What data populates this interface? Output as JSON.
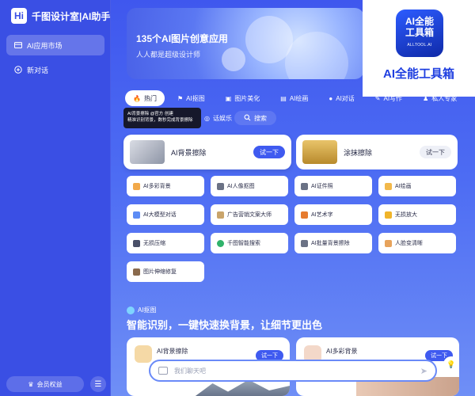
{
  "sidebar": {
    "logo_mark": "Hi",
    "logo_text": "千图设计室|AI助手",
    "items": [
      {
        "label": "AI应用市场",
        "icon": "app-store-icon"
      },
      {
        "label": "新对话",
        "icon": "plus-circle-icon"
      }
    ],
    "member_label": "会员权益",
    "menu_icon": "menu-icon"
  },
  "banner": {
    "title": "135个AI图片创意应用",
    "subtitle": "人人都是超级设计师"
  },
  "tabs": [
    {
      "label": "热门",
      "icon": "fire-icon",
      "active": true
    },
    {
      "label": "AI抠图",
      "icon": "cutout-icon"
    },
    {
      "label": "图片美化",
      "icon": "image-icon"
    },
    {
      "label": "AI绘画",
      "icon": "brush-icon"
    },
    {
      "label": "AI对话",
      "icon": "chat-icon"
    },
    {
      "label": "AI写作",
      "icon": "pen-icon"
    },
    {
      "label": "私人专家",
      "icon": "user-icon"
    }
  ],
  "tooltip": {
    "line1": "AI背景擦除 @官方 创建",
    "line2": "精准识别背景，数秒完成背景擦除"
  },
  "tabs_row2": [
    {
      "label": "话娱乐",
      "icon": "game-icon"
    },
    {
      "label": "搜索",
      "icon": "search-icon"
    }
  ],
  "featured": [
    {
      "title": "AI背景擦除",
      "button": "试一下",
      "primary": true
    },
    {
      "title": "涂抹擦除",
      "button": "试一下",
      "primary": false
    }
  ],
  "tools": [
    {
      "label": "AI多彩背景",
      "color": "#f2a94a"
    },
    {
      "label": "AI人像抠图",
      "color": "#6b7285"
    },
    {
      "label": "AI证件照",
      "color": "#6b7285"
    },
    {
      "label": "AI绘画",
      "color": "#f2b84a"
    },
    {
      "label": "AI大模型对话",
      "color": "#5d8cf5"
    },
    {
      "label": "广告营销文案大师",
      "color": "#c9a46b"
    },
    {
      "label": "AI艺术字",
      "color": "#e67b2e"
    },
    {
      "label": "无损放大",
      "color": "#f0b429"
    },
    {
      "label": "无损压缩",
      "color": "#4a5068"
    },
    {
      "label": "千图智能搜索",
      "color": "#30b36b"
    },
    {
      "label": "AI批量背景擦除",
      "color": "#6b7285"
    },
    {
      "label": "人脸变清晰",
      "color": "#e7a35c"
    },
    {
      "label": "图片伸缩修复",
      "color": "#8a6a4c"
    }
  ],
  "section": {
    "tag": "AI抠图",
    "title": "智能识别，一键快速换背景，让细节更出色"
  },
  "feature_cards": [
    {
      "title": "AI背景擦除",
      "button": "试一下"
    },
    {
      "title": "AI多彩背景",
      "button": "试一下"
    }
  ],
  "chat": {
    "placeholder": "我们聊天吧"
  },
  "overlay": {
    "logo_line1": "AI全能",
    "logo_line2": "工具箱",
    "logo_url": "ALLTOOL.AI",
    "title": "AI全能工具箱"
  }
}
